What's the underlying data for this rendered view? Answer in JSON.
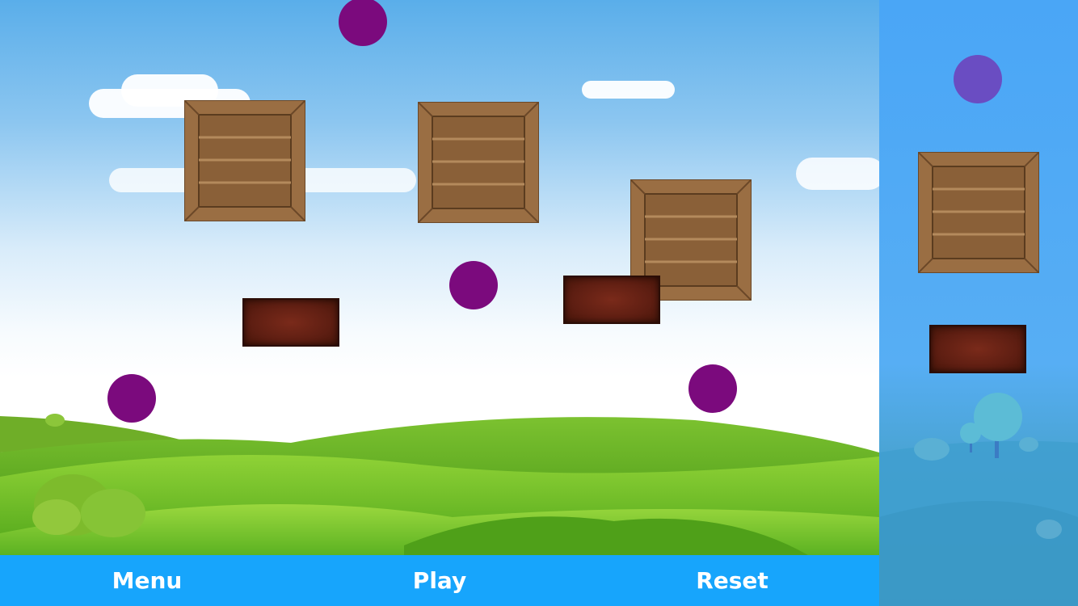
{
  "buttons": {
    "menu": "Menu",
    "play": "Play",
    "reset": "Reset"
  },
  "colors": {
    "ball": "#7b0a7d",
    "sidebar_ball": "#6a4dc2",
    "bottom_bar": "#17a5fc",
    "sky_top": "#5aaeea",
    "grass": "#6cc02a"
  },
  "scene_objects": {
    "crates": 3,
    "bricks": 2,
    "balls": 4
  },
  "sidebar_palette": [
    "ball",
    "crate",
    "brick"
  ]
}
